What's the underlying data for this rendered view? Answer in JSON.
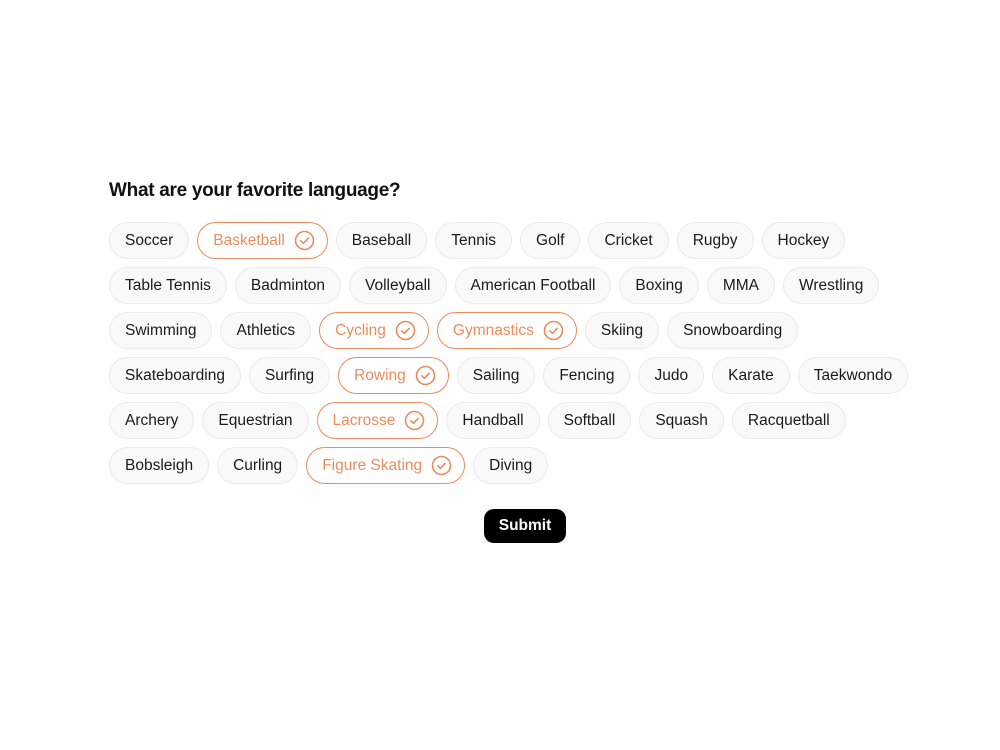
{
  "question": "What are your favorite language?",
  "accent_color": "#ec8c5e",
  "check_icon": "check-circle-icon",
  "options": [
    {
      "label": "Soccer",
      "selected": false
    },
    {
      "label": "Basketball",
      "selected": true
    },
    {
      "label": "Baseball",
      "selected": false
    },
    {
      "label": "Tennis",
      "selected": false
    },
    {
      "label": "Golf",
      "selected": false
    },
    {
      "label": "Cricket",
      "selected": false
    },
    {
      "label": "Rugby",
      "selected": false
    },
    {
      "label": "Hockey",
      "selected": false
    },
    {
      "label": "Table Tennis",
      "selected": false
    },
    {
      "label": "Badminton",
      "selected": false
    },
    {
      "label": "Volleyball",
      "selected": false
    },
    {
      "label": "American Football",
      "selected": false
    },
    {
      "label": "Boxing",
      "selected": false
    },
    {
      "label": "MMA",
      "selected": false
    },
    {
      "label": "Wrestling",
      "selected": false
    },
    {
      "label": "Swimming",
      "selected": false
    },
    {
      "label": "Athletics",
      "selected": false
    },
    {
      "label": "Cycling",
      "selected": true
    },
    {
      "label": "Gymnastics",
      "selected": true
    },
    {
      "label": "Skiing",
      "selected": false
    },
    {
      "label": "Snowboarding",
      "selected": false
    },
    {
      "label": "Skateboarding",
      "selected": false
    },
    {
      "label": "Surfing",
      "selected": false
    },
    {
      "label": "Rowing",
      "selected": true
    },
    {
      "label": "Sailing",
      "selected": false
    },
    {
      "label": "Fencing",
      "selected": false
    },
    {
      "label": "Judo",
      "selected": false
    },
    {
      "label": "Karate",
      "selected": false
    },
    {
      "label": "Taekwondo",
      "selected": false
    },
    {
      "label": "Archery",
      "selected": false
    },
    {
      "label": "Equestrian",
      "selected": false
    },
    {
      "label": "Lacrosse",
      "selected": true
    },
    {
      "label": "Handball",
      "selected": false
    },
    {
      "label": "Softball",
      "selected": false
    },
    {
      "label": "Squash",
      "selected": false
    },
    {
      "label": "Racquetball",
      "selected": false
    },
    {
      "label": "Bobsleigh",
      "selected": false
    },
    {
      "label": "Curling",
      "selected": false
    },
    {
      "label": "Figure Skating",
      "selected": true
    },
    {
      "label": "Diving",
      "selected": false
    }
  ],
  "submit_label": "Submit"
}
